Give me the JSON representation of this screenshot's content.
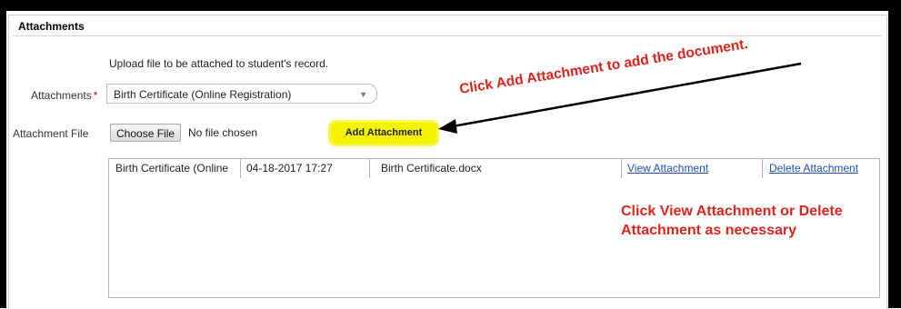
{
  "section": {
    "title": "Attachments"
  },
  "form": {
    "instruction": "Upload file to be attached to student's record.",
    "attachments_label": "Attachments",
    "required_marker": "*",
    "selected_type": "Birth Certificate (Online Registration)",
    "attachment_file_label": "Attachment File",
    "choose_file_label": "Choose File",
    "no_file_text": "No file chosen",
    "add_attachment_label": "Add Attachment"
  },
  "annotations": {
    "add_hint": "Click Add Attachment to add the document.",
    "view_delete_hint_line1": "Click View Attachment or Delete",
    "view_delete_hint_line2": "Attachment as necessary",
    "color": "#e0231c"
  },
  "attachments_table": {
    "rows": [
      {
        "type": "Birth Certificate (Online",
        "date": "04-18-2017 17:27",
        "filename": "Birth Certificate.docx",
        "view_label": "View Attachment",
        "delete_label": "Delete Attachment"
      }
    ]
  },
  "colors": {
    "highlight": "#f4f400",
    "link": "#1f4fb8"
  },
  "icons": {
    "dropdown": "chevron-down-icon"
  }
}
